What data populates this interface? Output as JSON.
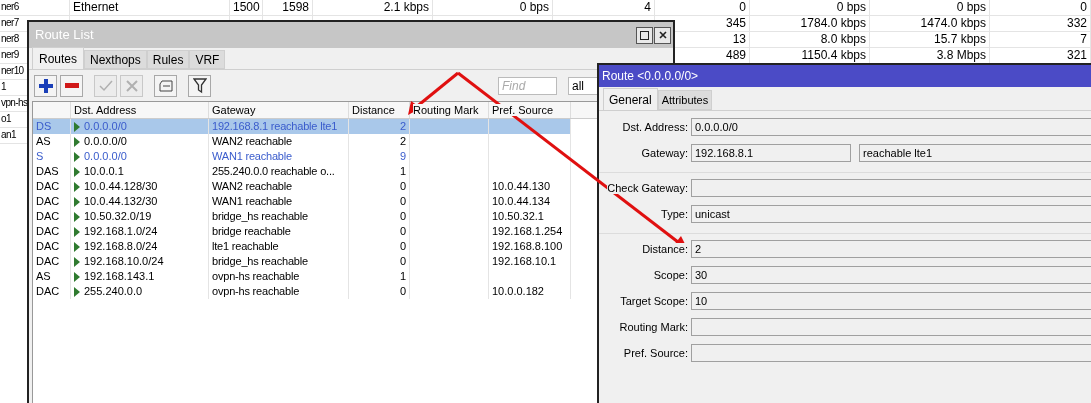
{
  "background_table": {
    "rows": [
      {
        "cells": [
          "ner6",
          "Ethernet",
          "1500",
          "1598",
          "2.1 kbps",
          "0 bps",
          "4",
          "0",
          "0 bps",
          "0 bps",
          "0"
        ]
      },
      {
        "cells": [
          "ner7",
          null,
          null,
          null,
          null,
          null,
          null,
          "345",
          "1784.0 kbps",
          "1474.0 kbps",
          "332"
        ]
      },
      {
        "cells": [
          "ner8",
          null,
          null,
          null,
          null,
          null,
          null,
          "13",
          "8.0 kbps",
          "15.7 kbps",
          "7"
        ]
      },
      {
        "cells": [
          "ner9",
          null,
          null,
          null,
          null,
          null,
          null,
          "489",
          "1150.4 kbps",
          "3.8 Mbps",
          "321"
        ]
      },
      {
        "cells": [
          "ner10",
          null,
          null,
          null,
          null,
          null,
          null,
          null,
          null,
          null,
          null
        ]
      },
      {
        "cells": [
          "1",
          null,
          null,
          null,
          null,
          null,
          null,
          null,
          null,
          null,
          null
        ]
      },
      {
        "cells": [
          "vpn-hs",
          null,
          null,
          null,
          null,
          null,
          null,
          null,
          null,
          null,
          null
        ]
      },
      {
        "cells": [
          "o1",
          null,
          null,
          null,
          null,
          null,
          null,
          null,
          null,
          null,
          null
        ]
      },
      {
        "cells": [
          "an1",
          null,
          null,
          null,
          null,
          null,
          null,
          null,
          null,
          null,
          null
        ]
      }
    ]
  },
  "route_list": {
    "title": "Route List",
    "tabs": [
      {
        "label": "Routes",
        "selected": true
      },
      {
        "label": "Nexthops",
        "selected": false
      },
      {
        "label": "Rules",
        "selected": false
      },
      {
        "label": "VRF",
        "selected": false
      }
    ],
    "toolbar": [
      {
        "kind": "add",
        "disabled": false
      },
      {
        "kind": "remove",
        "disabled": false
      },
      {
        "kind": "enable",
        "disabled": true
      },
      {
        "kind": "disable",
        "disabled": true
      },
      {
        "kind": "comment",
        "disabled": false
      },
      {
        "kind": "filter",
        "disabled": false
      }
    ],
    "find": {
      "placeholder": "Find"
    },
    "filter_select": {
      "value": "all"
    },
    "columns": [
      "Dst. Address",
      "Gateway",
      "Distance",
      "Routing Mark",
      "Pref. Source"
    ],
    "rows": [
      {
        "flags": "DS",
        "dst": "0.0.0.0/0",
        "gateway": "192.168.8.1 reachable lte1",
        "distance": "2",
        "selected": true,
        "highlighted": true
      },
      {
        "flags": "AS",
        "dst": "0.0.0.0/0",
        "gateway": "WAN2 reachable",
        "distance": "2",
        "selected": false,
        "highlighted": false
      },
      {
        "flags": "S",
        "dst": "0.0.0.0/0",
        "gateway": "WAN1 reachable",
        "distance": "9",
        "selected": false,
        "highlighted": true
      },
      {
        "flags": "DAS",
        "dst": "10.0.0.1",
        "gateway": "255.240.0.0 reachable o...",
        "distance": "1",
        "selected": false,
        "highlighted": false
      },
      {
        "flags": "DAC",
        "dst": "10.0.44.128/30",
        "gateway": "WAN2 reachable",
        "distance": "0",
        "pref_source": "10.0.44.130",
        "selected": false,
        "highlighted": false
      },
      {
        "flags": "DAC",
        "dst": "10.0.44.132/30",
        "gateway": "WAN1 reachable",
        "distance": "0",
        "pref_source": "10.0.44.134",
        "selected": false,
        "highlighted": false
      },
      {
        "flags": "DAC",
        "dst": "10.50.32.0/19",
        "gateway": "bridge_hs reachable",
        "distance": "0",
        "pref_source": "10.50.32.1",
        "selected": false,
        "highlighted": false
      },
      {
        "flags": "DAC",
        "dst": "192.168.1.0/24",
        "gateway": "bridge reachable",
        "distance": "0",
        "pref_source": "192.168.1.254",
        "selected": false,
        "highlighted": false
      },
      {
        "flags": "DAC",
        "dst": "192.168.8.0/24",
        "gateway": "lte1 reachable",
        "distance": "0",
        "pref_source": "192.168.8.100",
        "selected": false,
        "highlighted": false
      },
      {
        "flags": "DAC",
        "dst": "192.168.10.0/24",
        "gateway": "bridge_hs reachable",
        "distance": "0",
        "pref_source": "192.168.10.1",
        "selected": false,
        "highlighted": false
      },
      {
        "flags": "AS",
        "dst": "192.168.143.1",
        "gateway": "ovpn-hs reachable",
        "distance": "1",
        "selected": false,
        "highlighted": false
      },
      {
        "flags": "DAC",
        "dst": "255.240.0.0",
        "gateway": "ovpn-hs reachable",
        "distance": "0",
        "pref_source": "10.0.0.182",
        "selected": false,
        "highlighted": false
      }
    ]
  },
  "route_dialog": {
    "title": "Route <0.0.0.0/0>",
    "tabs": [
      {
        "label": "General",
        "selected": true
      },
      {
        "label": "Attributes",
        "selected": false
      }
    ],
    "groups": [
      [
        {
          "label": "Dst. Address:",
          "value": "0.0.0.0/0"
        },
        {
          "label": "Gateway:",
          "value": "192.168.8.1",
          "value2": "reachable lte1"
        }
      ],
      [
        {
          "label": "Check Gateway:"
        },
        {
          "label": "Type:",
          "value": "unicast"
        }
      ],
      [
        {
          "label": "Distance:",
          "value": "2"
        },
        {
          "label": "Scope:",
          "value": "30"
        },
        {
          "label": "Target Scope:",
          "value": "10"
        },
        {
          "label": "Routing Mark:"
        },
        {
          "label": "Pref. Source:"
        }
      ]
    ]
  }
}
